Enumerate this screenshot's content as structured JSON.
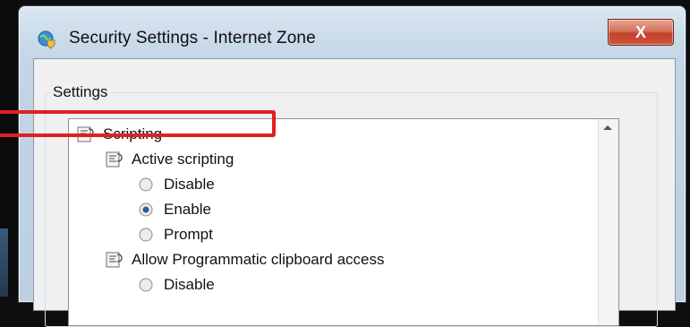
{
  "window": {
    "title": "Security Settings - Internet Zone",
    "close_symbol": "X",
    "title_icon": "globe-shield-icon"
  },
  "group": {
    "label": "Settings"
  },
  "tree": [
    {
      "type": "category",
      "label": "Scripting",
      "icon": "script-doc-icon"
    },
    {
      "type": "setting",
      "label": "Active scripting",
      "icon": "script-doc-icon"
    },
    {
      "type": "option",
      "label": "Disable",
      "checked": false
    },
    {
      "type": "option",
      "label": "Enable",
      "checked": true
    },
    {
      "type": "option",
      "label": "Prompt",
      "checked": false
    },
    {
      "type": "setting",
      "label": "Allow Programmatic clipboard access",
      "icon": "script-doc-icon"
    },
    {
      "type": "option",
      "label": "Disable",
      "checked": false
    }
  ],
  "colors": {
    "highlight": "#e02020",
    "close_button": "#c2412a",
    "frame": "#c2d4e5"
  }
}
